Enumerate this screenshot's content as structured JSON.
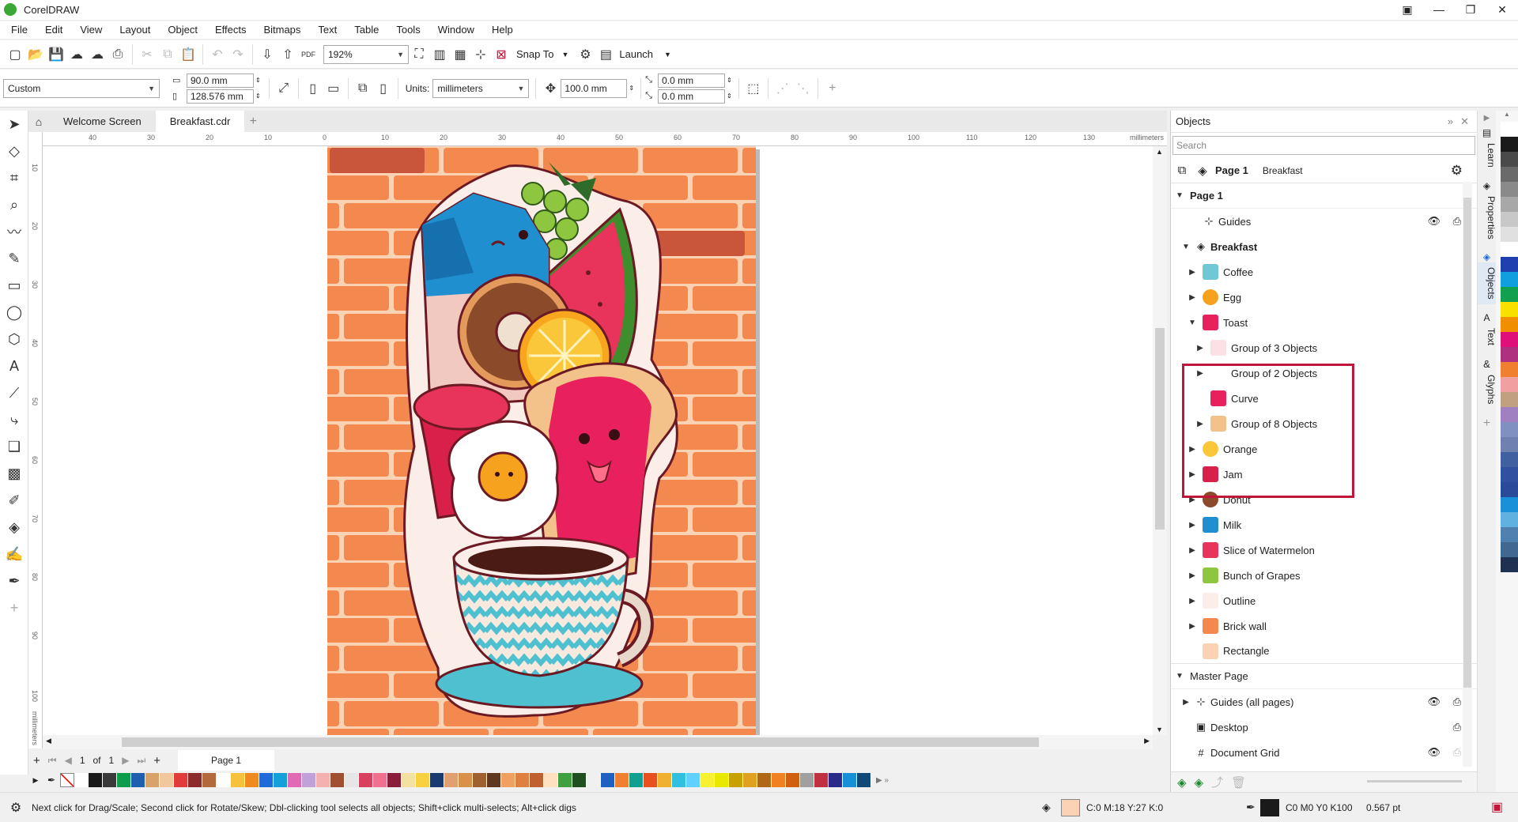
{
  "app": {
    "title": "CorelDRAW"
  },
  "menu": [
    "File",
    "Edit",
    "View",
    "Layout",
    "Object",
    "Effects",
    "Bitmaps",
    "Text",
    "Table",
    "Tools",
    "Window",
    "Help"
  ],
  "toolbar": {
    "zoom": "192%",
    "snap_to": "Snap To",
    "launch": "Launch",
    "pdf": "PDF"
  },
  "propbar": {
    "preset": "Custom",
    "width": "90.0 mm",
    "height": "128.576 mm",
    "units_label": "Units:",
    "units_value": "millimeters",
    "nudge": "100.0 mm",
    "dup_x": "0.0 mm",
    "dup_y": "0.0 mm"
  },
  "tabs": {
    "welcome": "Welcome Screen",
    "file": "Breakfast.cdr"
  },
  "ruler": {
    "h_ticks": [
      "40",
      "30",
      "20",
      "10",
      "0",
      "10",
      "20",
      "30",
      "40",
      "50",
      "60",
      "70",
      "80",
      "90",
      "100",
      "110",
      "120",
      "130"
    ],
    "h_unit": "millimeters",
    "v_ticks": [
      "10",
      "20",
      "30",
      "40",
      "50",
      "60",
      "70",
      "80",
      "90",
      "100",
      "110",
      "120"
    ],
    "v_unit": "millimeters"
  },
  "pagenav": {
    "current": "1",
    "of": "of",
    "total": "1",
    "page_tab": "Page 1"
  },
  "status": {
    "hint": "Next click for Drag/Scale; Second click for Rotate/Skew; Dbl-clicking tool selects all objects; Shift+click multi-selects; Alt+click digs",
    "fill": "C:0 M:18 Y:27 K:0",
    "outline": "C0 M0 Y0 K100",
    "outline_width": "0.567 pt",
    "fill_color": "#fbd2b4"
  },
  "docker": {
    "title": "Objects",
    "search_placeholder": "Search",
    "page_label": "Page 1",
    "layer_label": "Breakfast",
    "tree": {
      "page1": "Page 1",
      "guides": "Guides",
      "breakfast": "Breakfast",
      "coffee": "Coffee",
      "egg": "Egg",
      "toast": "Toast",
      "group3": "Group of 3 Objects",
      "group2": "Group of 2 Objects",
      "curve": "Curve",
      "group8": "Group of 8 Objects",
      "orange": "Orange",
      "jam": "Jam",
      "donut": "Donut",
      "milk": "Milk",
      "watermelon": "Slice of Watermelon",
      "grapes": "Bunch of Grapes",
      "outline": "Outline",
      "brickwall": "Brick wall",
      "rectangle": "Rectangle",
      "master": "Master Page",
      "guides_all": "Guides (all pages)",
      "desktop": "Desktop",
      "docgrid": "Document Grid"
    }
  },
  "side_tabs": [
    "Learn",
    "Properties",
    "Objects",
    "Text",
    "Glyphs"
  ],
  "colors": {
    "highlight": "#c0163a",
    "brick": "#f4894f",
    "brick_dark": "#c9553a",
    "mortar": "#fbd2b4"
  },
  "palette_bottom": [
    "#ffffff",
    "#1a1a1a",
    "#3a3a3a",
    "#0e9e4b",
    "#1f5fb0",
    "#d9a26b",
    "#f2c79b",
    "#e23b3b",
    "#8b2b2b",
    "#b26a3c",
    "#ffffff",
    "#f7c23b",
    "#f08a1f",
    "#1d6ad8",
    "#14a0d8",
    "#e06ab4",
    "#c2a0d8",
    "#f5b0b0",
    "#a05030",
    "#e6e6e6",
    "#d84060",
    "#f07090",
    "#8a1e3a",
    "#f4e0a0",
    "#f8d040",
    "#1a3a70",
    "#e0a070",
    "#d8904a",
    "#a06030",
    "#603820",
    "#f0a060",
    "#e08040",
    "#c06030",
    "#ffe0c0",
    "#40a040",
    "#205020",
    "#f0f0f0",
    "#2060c0",
    "#f08030",
    "#10a090",
    "#e85020",
    "#f0b030",
    "#30c0e0",
    "#60d0ff",
    "#f8f030",
    "#e8e800",
    "#c8a000",
    "#e0a020",
    "#b06818",
    "#f08020",
    "#d06010",
    "#a0a0a0",
    "#c03040",
    "#2a2a8a",
    "#1890d8",
    "#104878"
  ],
  "palette_right": [
    "#ffffff",
    "#1a1a1a",
    "#4a4a4a",
    "#6a6a6a",
    "#8a8a8a",
    "#a8a8a8",
    "#c8c8c8",
    "#e0e0e0",
    "#ffffff",
    "#2040b0",
    "#10a0e0",
    "#10a050",
    "#f8e000",
    "#f09000",
    "#e0107a",
    "#b03080",
    "#f08030",
    "#f0a0a0",
    "#c0a080",
    "#a080c0",
    "#8090c0",
    "#7080b0",
    "#4060a0",
    "#3050a0",
    "#2a4a9a",
    "#1a90d8",
    "#60b0e0",
    "#5080b0",
    "#406890",
    "#203050"
  ]
}
